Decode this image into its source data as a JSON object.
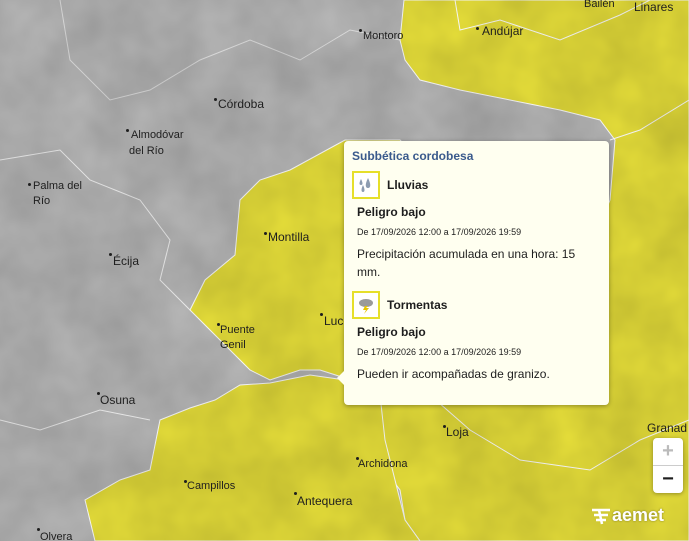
{
  "colors": {
    "warning_yellow": "#e8e03a",
    "no_warning_gray": "#b8b8b8",
    "popup_bg": "#fffff0",
    "title_blue": "#3a5a8c"
  },
  "places": {
    "bailen": "Bailén",
    "linares": "Linares",
    "montoro": "Montoro",
    "andujar": "Andújar",
    "cordoba": "Córdoba",
    "almodovar_1": "Almodóvar",
    "almodovar_2": "del Río",
    "palma_1": "Palma del",
    "palma_2": "Río",
    "montilla": "Montilla",
    "ecija": "Écija",
    "puente_1": "Puente",
    "puente_2": "Genil",
    "lucena": "Luce",
    "osuna": "Osuna",
    "loja": "Loja",
    "granada": "Granad",
    "archidona": "Archidona",
    "campillos": "Campillos",
    "antequera": "Antequera",
    "olvera": "Olvera"
  },
  "popup": {
    "zone_title": "Subbética cordobesa",
    "warnings": [
      {
        "icon": "rain-icon",
        "name": "Lluvias",
        "level": "Peligro bajo",
        "dates": "De 17/09/2026 12:00 a 17/09/2026 19:59",
        "description": "Precipitación acumulada en una hora: 15 mm."
      },
      {
        "icon": "storm-icon",
        "name": "Tormentas",
        "level": "Peligro bajo",
        "dates": "De 17/09/2026 12:00 a 17/09/2026 19:59",
        "description": "Pueden ir acompañadas de granizo."
      }
    ]
  },
  "controls": {
    "zoom_in": "+",
    "zoom_out": "−"
  },
  "brand": {
    "logo_text": "aemet"
  }
}
